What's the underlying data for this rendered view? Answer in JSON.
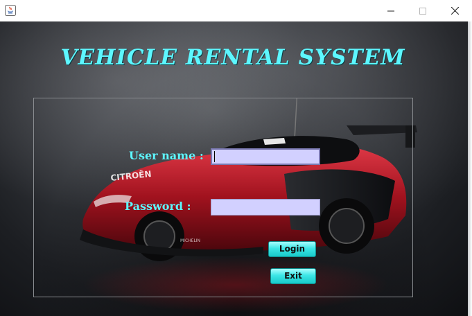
{
  "window": {
    "controls": {
      "minimize_icon": "minimize-icon",
      "maximize_icon": "maximize-icon",
      "close_icon": "close-icon"
    }
  },
  "app": {
    "title": "VEHICLE RENTAL SYSTEM",
    "accent_color": "#5df7ff"
  },
  "form": {
    "username_label": "User name :",
    "username_value": "",
    "password_label": "Password :",
    "password_value": "",
    "field_color": "#d2d0ff"
  },
  "buttons": {
    "login_label": "Login",
    "exit_label": "Exit",
    "color": "#3ce6e6"
  },
  "background": {
    "image": "red sports car (Citroën concept) on dark foggy backdrop"
  }
}
